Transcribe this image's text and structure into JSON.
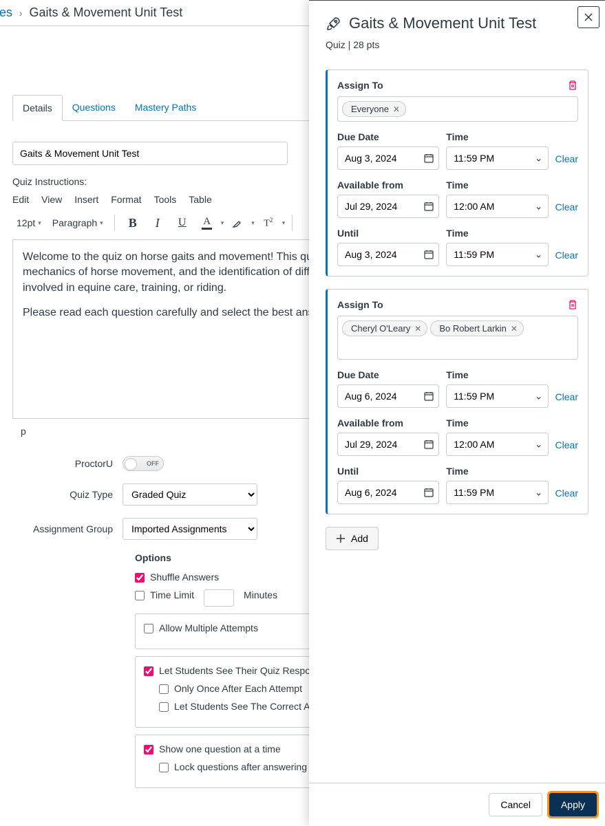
{
  "breadcrumb": {
    "link": "zes",
    "current": "Gaits & Movement Unit Test"
  },
  "tabs": [
    {
      "label": "Details",
      "active": true
    },
    {
      "label": "Questions",
      "active": false
    },
    {
      "label": "Mastery Paths",
      "active": false
    }
  ],
  "quiz_title_value": "Gaits & Movement Unit Test",
  "instructions_label": "Quiz Instructions:",
  "editor_menu": [
    "Edit",
    "View",
    "Insert",
    "Format",
    "Tools",
    "Table"
  ],
  "toolbar": {
    "font_size": "12pt",
    "block": "Paragraph"
  },
  "editor_content_p1": "Welcome to the quiz on horse gaits and movement! This quiz will test your knowledge of the various gaits, the mechanics of horse movement, and the identification of different gaits. Understanding gaits is crucial for anyone involved in equine care, training, or riding.",
  "editor_content_p2": "Please read each question carefully and select the best answer. Good luck!",
  "editor_status_path": "p",
  "settings": {
    "proctoru_label": "ProctorU",
    "proctoru_state": "OFF",
    "quiz_type_label": "Quiz Type",
    "quiz_type_value": "Graded Quiz",
    "assignment_group_label": "Assignment Group",
    "assignment_group_value": "Imported Assignments"
  },
  "options": {
    "heading": "Options",
    "shuffle": "Shuffle Answers",
    "time_limit": "Time Limit",
    "minutes": "Minutes",
    "allow_multiple": "Allow Multiple Attempts",
    "see_responses": "Let Students See Their Quiz Responses (Incorrect Questions Will Be Marked in Student Feedback)",
    "only_once": "Only Once After Each Attempt",
    "see_correct": "Let Students See The Correct Answers",
    "one_at_time": "Show one question at a time",
    "lock_after": "Lock questions after answering"
  },
  "tray": {
    "title": "Gaits & Movement Unit Test",
    "subtitle": "Quiz | 28 pts",
    "assign_to_label": "Assign To",
    "due_date_label": "Due Date",
    "time_label": "Time",
    "available_from_label": "Available from",
    "until_label": "Until",
    "clear": "Clear",
    "add": "Add",
    "cancel": "Cancel",
    "apply": "Apply",
    "cards": [
      {
        "assignees": [
          "Everyone"
        ],
        "due_date": "Aug 3, 2024",
        "due_time": "11:59 PM",
        "from_date": "Jul 29, 2024",
        "from_time": "12:00 AM",
        "until_date": "Aug 3, 2024",
        "until_time": "11:59 PM"
      },
      {
        "assignees": [
          "Cheryl O'Leary",
          "Bo Robert Larkin"
        ],
        "due_date": "Aug 6, 2024",
        "due_time": "11:59 PM",
        "from_date": "Jul 29, 2024",
        "from_time": "12:00 AM",
        "until_date": "Aug 6, 2024",
        "until_time": "11:59 PM"
      }
    ]
  }
}
